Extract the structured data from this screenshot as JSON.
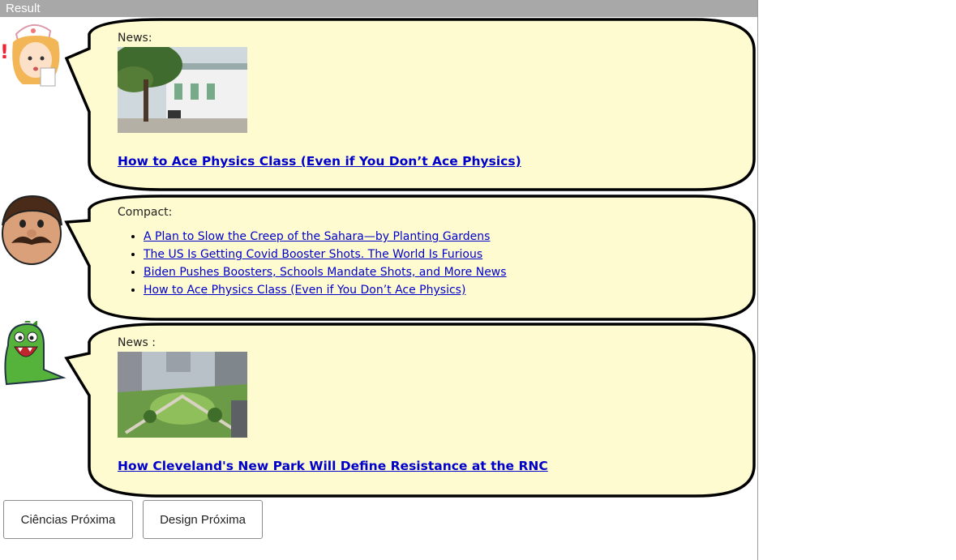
{
  "frame": {
    "title": "Result"
  },
  "posts": [
    {
      "label": "News:",
      "image_desc": "campus-building-photo",
      "headline": "How to Ace Physics Class (Even if You Don’t Ace Physics)"
    },
    {
      "label": "Compact:",
      "links": [
        "A Plan to Slow the Creep of the Sahara—by Planting Gardens",
        "The US Is Getting Covid Booster Shots. The World Is Furious",
        "Biden Pushes Boosters, Schools Mandate Shots, and More News",
        "How to Ace Physics Class (Even if You Don’t Ace Physics)"
      ]
    },
    {
      "label": "News :",
      "image_desc": "city-park-aerial-photo",
      "headline": "How Cleveland's New Park Will Define Resistance at the RNC"
    }
  ],
  "buttons": {
    "ciencias": "Ciências Próxima",
    "design": "Design Próxima"
  },
  "colors": {
    "bubble_fill": "#fffbd0",
    "bubble_stroke": "#000000",
    "link": "#0000cc",
    "result_bar": "#a8a8a8"
  }
}
